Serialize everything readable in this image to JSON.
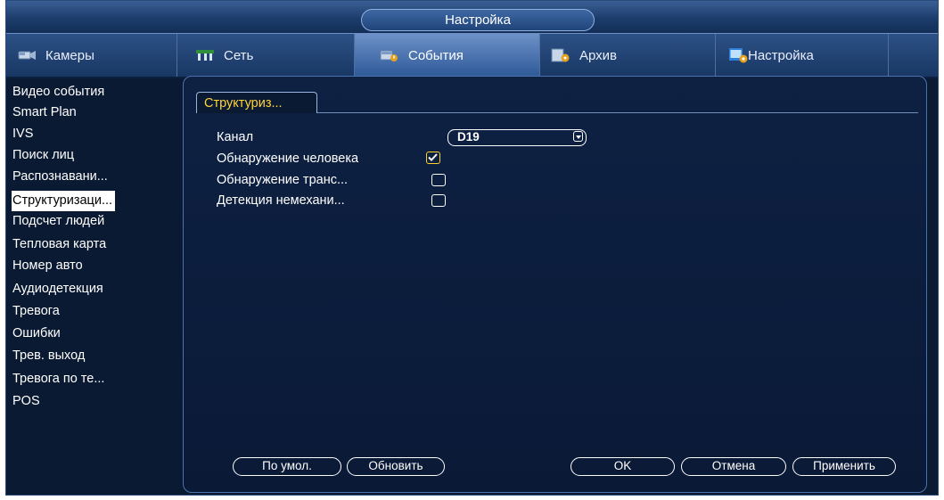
{
  "window": {
    "title": "Настройка"
  },
  "tabs": [
    {
      "label": "Камеры",
      "icon": "camera-icon"
    },
    {
      "label": "Сеть",
      "icon": "network-icon"
    },
    {
      "label": "События",
      "icon": "events-icon",
      "active": true
    },
    {
      "label": "Архив",
      "icon": "storage-icon"
    },
    {
      "label": "Настройка",
      "icon": "settings-icon"
    }
  ],
  "sidebar": {
    "items": [
      {
        "label": "Видео события"
      },
      {
        "label": "Smart Plan"
      },
      {
        "label": "IVS"
      },
      {
        "label": "Поиск лиц"
      },
      {
        "label": "Распознавани..."
      },
      {
        "label": "Структуризаци...",
        "active": true
      },
      {
        "label": "Подсчет людей"
      },
      {
        "label": "Тепловая карта"
      },
      {
        "label": "Номер авто"
      },
      {
        "label": "Аудиодетекция"
      },
      {
        "label": "Тревога"
      },
      {
        "label": "Ошибки"
      },
      {
        "label": "Трев. выход"
      },
      {
        "label": "Тревога по те..."
      },
      {
        "label": "POS"
      }
    ]
  },
  "panel": {
    "subtab": "Структуриз...",
    "channel_label": "Канал",
    "channel_value": "D19",
    "options": [
      {
        "label": "Обнаружение человека",
        "checked": true
      },
      {
        "label": "Обнаружение транс...",
        "checked": false
      },
      {
        "label": "Детекция немехани...",
        "checked": false
      }
    ]
  },
  "buttons": {
    "default": "По умол.",
    "refresh": "Обновить",
    "ok": "OK",
    "cancel": "Отмена",
    "apply": "Применить"
  },
  "colors": {
    "background": "#0b1a33",
    "highlight": "#ffd338",
    "check": "#ffcf2e"
  }
}
